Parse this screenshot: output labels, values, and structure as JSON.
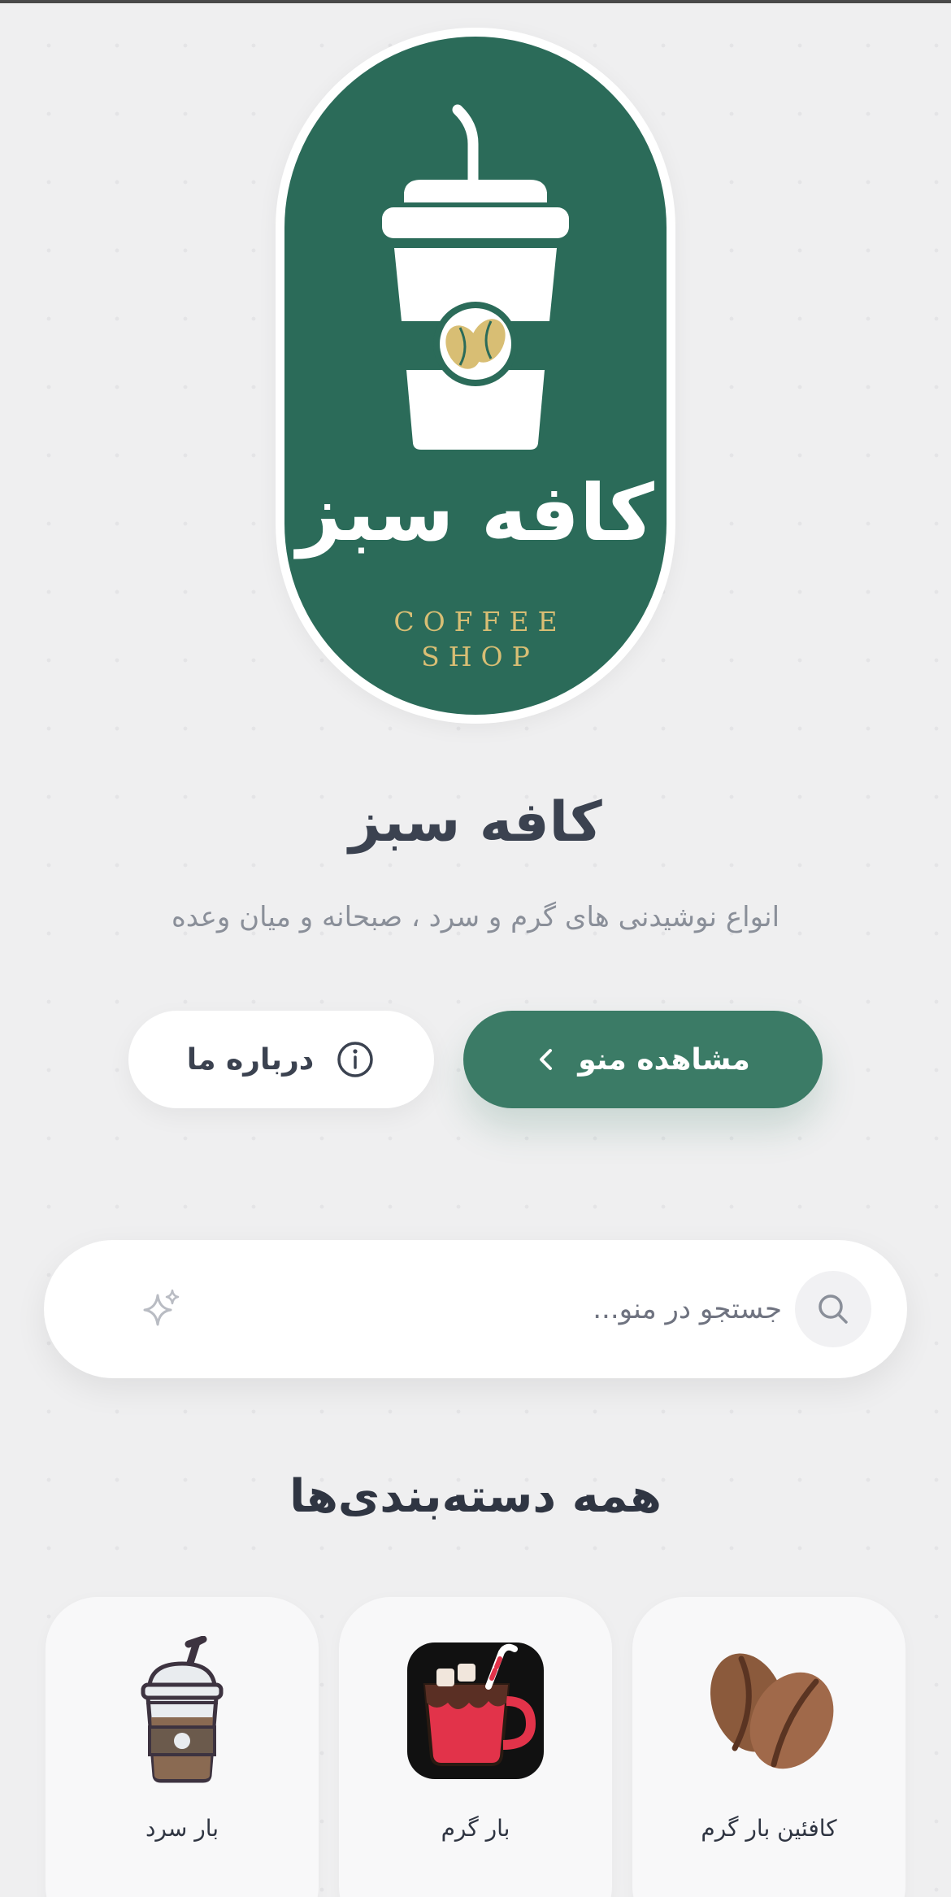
{
  "logo": {
    "name": "کافه سبز",
    "subtitle_line1": "COFFEE",
    "subtitle_line2": "SHOP",
    "colors": {
      "background": "#2b6b59",
      "accent": "#d8be74"
    }
  },
  "header": {
    "title": "کافه سبز",
    "subtitle": "انواع نوشیدنی های گرم و سرد ، صبحانه و میان وعده"
  },
  "actions": {
    "menu_label": "مشاهده منو",
    "about_label": "درباره ما"
  },
  "search": {
    "placeholder": "جستجو در منو...",
    "value": ""
  },
  "categories_section": {
    "title": "همه دسته‌بندی‌ها",
    "items": [
      {
        "label": "کافئین بار گرم",
        "icon": "coffee-beans-icon"
      },
      {
        "label": "بار گرم",
        "icon": "hot-chocolate-icon"
      },
      {
        "label": "بار سرد",
        "icon": "iced-coffee-icon"
      }
    ]
  },
  "theme": {
    "primary": "#3b7b66",
    "text": "#3b4250",
    "muted": "#8a8f99"
  }
}
